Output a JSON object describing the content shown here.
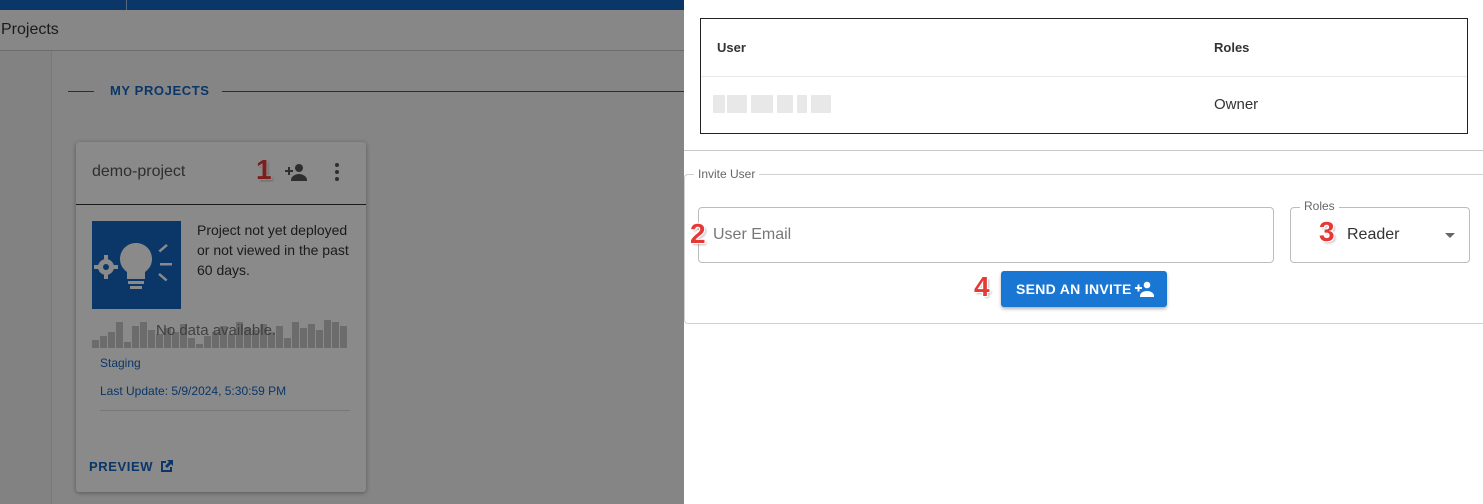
{
  "header": {
    "breadcrumb": "Projects"
  },
  "section": {
    "title": "MY PROJECTS"
  },
  "project_card": {
    "name": "demo-project",
    "status_text": "Project not yet deployed or not viewed in the past 60 days.",
    "no_data": "No data available.",
    "environment": "Staging",
    "last_update": "Last Update: 5/9/2024, 5:30:59 PM",
    "preview_label": "PREVIEW",
    "icons": {
      "add_user": "person-add-icon",
      "more": "more-vert-icon",
      "preview": "open-in-new-icon",
      "project": "lightbulb-gear-icon"
    }
  },
  "drawer": {
    "table": {
      "headers": {
        "user": "User",
        "roles": "Roles"
      },
      "rows": [
        {
          "user": "",
          "role": "Owner"
        }
      ]
    },
    "invite": {
      "legend": "Invite User",
      "email_placeholder": "User Email",
      "roles_label": "Roles",
      "roles_value": "Reader",
      "send_label": "SEND AN INVITE"
    }
  },
  "annotations": [
    "1",
    "2",
    "3",
    "4"
  ],
  "colors": {
    "primary": "#1565c0",
    "button": "#1976d2",
    "annotation": "#e53935"
  }
}
